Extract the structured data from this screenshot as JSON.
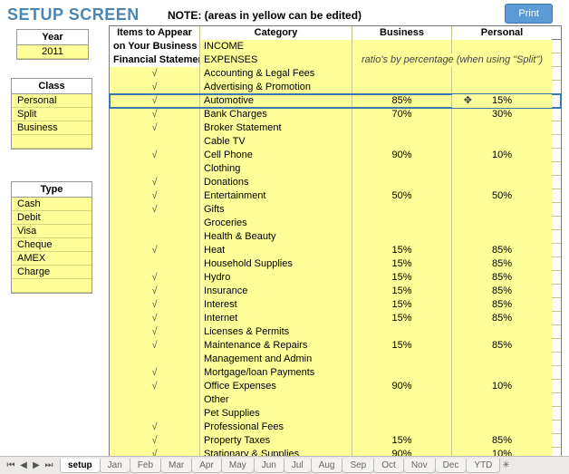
{
  "title": "SETUP SCREEN",
  "note": "NOTE: (areas in yellow can be edited)",
  "print_label": "Print",
  "year": {
    "header": "Year",
    "value": "2011"
  },
  "class": {
    "header": "Class",
    "items": [
      "Personal",
      "Split",
      "Business",
      ""
    ]
  },
  "type": {
    "header": "Type",
    "items": [
      "Cash",
      "Debit",
      "Visa",
      "Cheque",
      "AMEX",
      "Charge",
      ""
    ]
  },
  "main": {
    "items_head_1": "Items to Appear",
    "items_head_2": "on Your Business",
    "items_head_3": "Financial Statement",
    "cat_head": "Category",
    "bus_head": "Business",
    "per_head": "Personal",
    "income_label": "INCOME",
    "expenses_label": "EXPENSES",
    "ratios_note": "ratio's by percentage (when using \"Split\")",
    "rows": [
      {
        "chk": "√",
        "cat": "Accounting & Legal Fees",
        "bus": "",
        "per": ""
      },
      {
        "chk": "√",
        "cat": "Advertising & Promotion",
        "bus": "",
        "per": ""
      },
      {
        "chk": "√",
        "cat": "Automotive",
        "bus": "85%",
        "per": "15%",
        "selected": true
      },
      {
        "chk": "√",
        "cat": "Bank Charges",
        "bus": "70%",
        "per": "30%"
      },
      {
        "chk": "√",
        "cat": "Broker Statement",
        "bus": "",
        "per": ""
      },
      {
        "chk": "",
        "cat": "Cable TV",
        "bus": "",
        "per": ""
      },
      {
        "chk": "√",
        "cat": "Cell Phone",
        "bus": "90%",
        "per": "10%"
      },
      {
        "chk": "",
        "cat": "Clothing",
        "bus": "",
        "per": ""
      },
      {
        "chk": "√",
        "cat": "Donations",
        "bus": "",
        "per": ""
      },
      {
        "chk": "√",
        "cat": "Entertainment",
        "bus": "50%",
        "per": "50%"
      },
      {
        "chk": "√",
        "cat": "Gifts",
        "bus": "",
        "per": ""
      },
      {
        "chk": "",
        "cat": "Groceries",
        "bus": "",
        "per": ""
      },
      {
        "chk": "",
        "cat": "Health & Beauty",
        "bus": "",
        "per": ""
      },
      {
        "chk": "√",
        "cat": "Heat",
        "bus": "15%",
        "per": "85%"
      },
      {
        "chk": "",
        "cat": "Household Supplies",
        "bus": "15%",
        "per": "85%"
      },
      {
        "chk": "√",
        "cat": "Hydro",
        "bus": "15%",
        "per": "85%"
      },
      {
        "chk": "√",
        "cat": "Insurance",
        "bus": "15%",
        "per": "85%"
      },
      {
        "chk": "√",
        "cat": "Interest",
        "bus": "15%",
        "per": "85%"
      },
      {
        "chk": "√",
        "cat": "Internet",
        "bus": "15%",
        "per": "85%"
      },
      {
        "chk": "√",
        "cat": "Licenses & Permits",
        "bus": "",
        "per": ""
      },
      {
        "chk": "√",
        "cat": "Maintenance & Repairs",
        "bus": "15%",
        "per": "85%"
      },
      {
        "chk": "",
        "cat": "Management and Admin",
        "bus": "",
        "per": ""
      },
      {
        "chk": "√",
        "cat": "Mortgage/loan Payments",
        "bus": "",
        "per": ""
      },
      {
        "chk": "√",
        "cat": "Office Expenses",
        "bus": "90%",
        "per": "10%"
      },
      {
        "chk": "",
        "cat": "Other",
        "bus": "",
        "per": ""
      },
      {
        "chk": "",
        "cat": "Pet Supplies",
        "bus": "",
        "per": ""
      },
      {
        "chk": "√",
        "cat": "Professional Fees",
        "bus": "",
        "per": ""
      },
      {
        "chk": "√",
        "cat": "Property Taxes",
        "bus": "15%",
        "per": "85%"
      },
      {
        "chk": "√",
        "cat": "Stationary & Supplies",
        "bus": "90%",
        "per": "10%"
      }
    ]
  },
  "tabs": [
    "setup",
    "Jan",
    "Feb",
    "Mar",
    "Apr",
    "May",
    "Jun",
    "Jul",
    "Aug",
    "Sep",
    "Oct",
    "Nov",
    "Dec",
    "YTD"
  ],
  "tab_active": 0
}
